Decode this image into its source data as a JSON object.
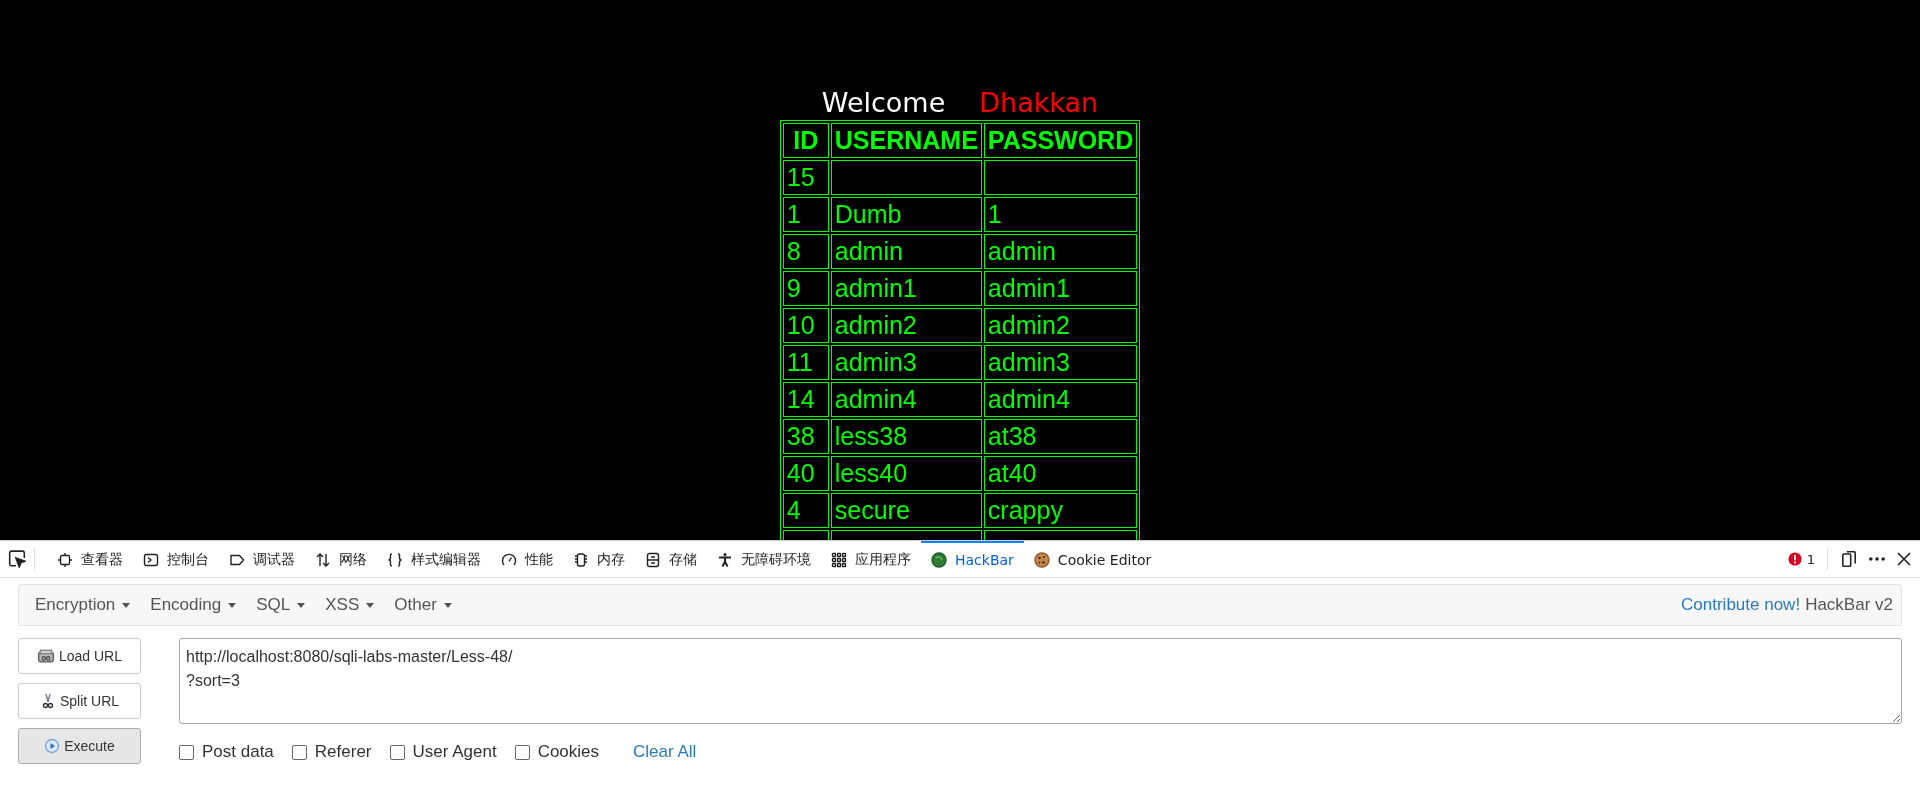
{
  "page": {
    "welcome": "Welcome",
    "user": "Dhakkan",
    "table": {
      "columns": [
        "ID",
        "USERNAME",
        "PASSWORD"
      ],
      "rows": [
        {
          "id": "15"
        },
        {
          "id": "1",
          "username": "Dumb",
          "password": "1"
        },
        {
          "id": "8",
          "username": "admin",
          "password": "admin"
        },
        {
          "id": "9",
          "username": "admin1",
          "password": "admin1"
        },
        {
          "id": "10",
          "username": "admin2",
          "password": "admin2"
        },
        {
          "id": "11",
          "username": "admin3",
          "password": "admin3"
        },
        {
          "id": "14",
          "username": "admin4",
          "password": "admin4"
        },
        {
          "id": "38",
          "username": "less38",
          "password": "at38"
        },
        {
          "id": "40",
          "username": "less40",
          "password": "at40"
        },
        {
          "id": "4",
          "username": "secure",
          "password": "crappy"
        }
      ]
    }
  },
  "devtools": {
    "tabs": [
      {
        "label": "查看器",
        "kind": "inspector",
        "selected": false
      },
      {
        "label": "控制台",
        "kind": "console",
        "selected": false
      },
      {
        "label": "调试器",
        "kind": "debugger",
        "selected": false
      },
      {
        "label": "网络",
        "kind": "network",
        "selected": false
      },
      {
        "label": "样式编辑器",
        "kind": "style",
        "selected": false
      },
      {
        "label": "性能",
        "kind": "performance",
        "selected": false
      },
      {
        "label": "内存",
        "kind": "memory",
        "selected": false
      },
      {
        "label": "存储",
        "kind": "storage",
        "selected": false
      },
      {
        "label": "无障碍环境",
        "kind": "accessibility",
        "selected": false
      },
      {
        "label": "应用程序",
        "kind": "apps",
        "selected": false
      },
      {
        "label": "HackBar",
        "kind": "hackbar",
        "selected": true
      },
      {
        "label": "Cookie Editor",
        "kind": "cookie",
        "selected": false
      }
    ],
    "error_count": "1"
  },
  "hackbar": {
    "menus": [
      "Encryption",
      "Encoding",
      "SQL",
      "XSS",
      "Other"
    ],
    "contribute_link": "Contribute now!",
    "version": "HackBar v2",
    "buttons": [
      {
        "label": "Load URL",
        "kind": "load",
        "pressed": false
      },
      {
        "label": "Split URL",
        "kind": "split",
        "pressed": false
      },
      {
        "label": "Execute",
        "kind": "execute",
        "pressed": true
      }
    ],
    "url": "http://localhost:8080/sqli-labs-master/Less-48/\n?sort=3",
    "options": [
      {
        "label": "Post data",
        "checked": false
      },
      {
        "label": "Referer",
        "checked": false
      },
      {
        "label": "User Agent",
        "checked": false
      },
      {
        "label": "Cookies",
        "checked": false
      }
    ],
    "clear_all": "Clear All"
  }
}
